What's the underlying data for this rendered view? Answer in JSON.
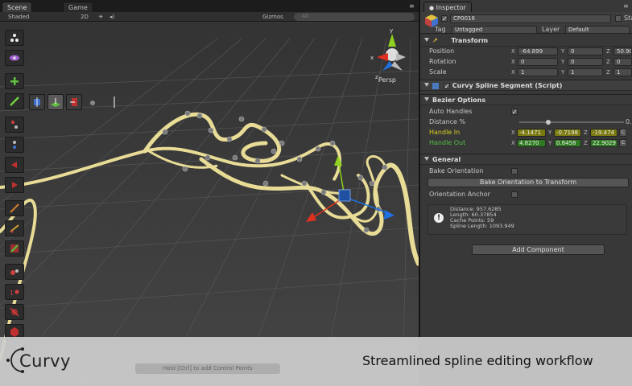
{
  "scene": {
    "tabs": [
      {
        "label": "Scene"
      },
      {
        "label": "Game"
      }
    ],
    "toolbar": {
      "shading": "Shaded",
      "mode_2d": "2D",
      "gizmos": "Gizmos",
      "search_placeholder": "All"
    },
    "view_label": "Persp"
  },
  "caption": {
    "brand": "Curvy",
    "text": "Streamlined spline editing workflow",
    "hint": "Hold [Ctrl] to add Control Points"
  },
  "inspector": {
    "tab_label": "Inspector",
    "object_name": "CP0016",
    "static_label": "Sta",
    "tag_label": "Tag",
    "tag_value": "Untagged",
    "layer_label": "Layer",
    "layer_value": "Default",
    "transform": {
      "title": "Transform",
      "rows": [
        {
          "label": "Position",
          "x": "-64.899",
          "y": "0",
          "z": "50.90"
        },
        {
          "label": "Rotation",
          "x": "0",
          "y": "0",
          "z": "0"
        },
        {
          "label": "Scale",
          "x": "1",
          "y": "1",
          "z": "1"
        }
      ]
    },
    "component_title": "Curvy Spline Segment (Script)",
    "bezier": {
      "title": "Bezier Options",
      "auto_handles_label": "Auto Handles",
      "auto_handles_checked": true,
      "distance_label": "Distance %",
      "distance_fraction": 0.28,
      "distance_value": "0.",
      "handle_in": {
        "label": "Handle In",
        "x": "-4.1471",
        "y": "-0.7198",
        "z": "-19.474"
      },
      "handle_out": {
        "label": "Handle Out",
        "x": "4.8270",
        "y": "0.8458",
        "z": "22.9029"
      },
      "handle_btn": "C"
    },
    "general": {
      "title": "General",
      "bake_orientation_label": "Bake Orientation",
      "bake_button": "Bake Orientation to Transform",
      "orientation_anchor_label": "Orientation Anchor",
      "info": [
        "Distance: 957.6285",
        "Length: 60.37854",
        "Cache Points: 59",
        "Spline Length: 1093.949"
      ]
    },
    "add_component": "Add Component"
  },
  "colors": {
    "spline": "#e8dc96",
    "axis_x": "#e03020",
    "axis_y": "#90d020",
    "axis_z": "#2070e0",
    "handle_in_bg": "#7a7a10",
    "handle_out_bg": "#2e7a20"
  }
}
